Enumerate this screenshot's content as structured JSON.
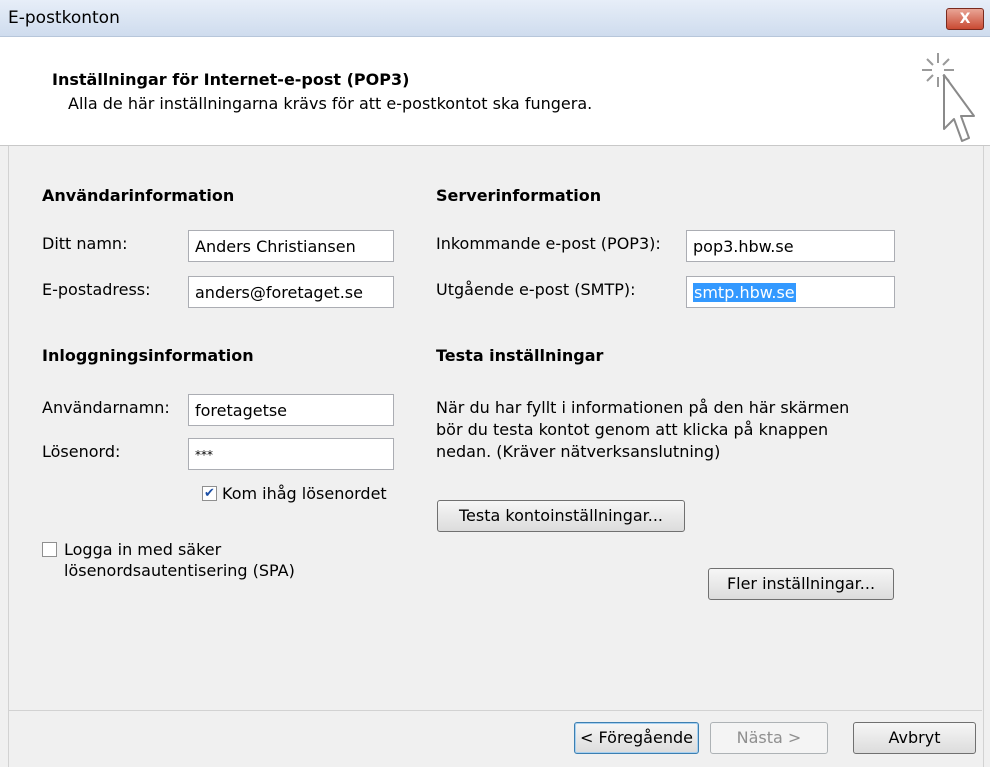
{
  "window": {
    "title": "E-postkonton",
    "close_label": "X"
  },
  "header": {
    "title": "Inställningar för Internet-e-post (POP3)",
    "subtitle": "Alla de här inställningarna krävs för att e-postkontot ska fungera.",
    "icon": "sparkle-cursor-icon"
  },
  "user_info": {
    "heading": "Användarinformation",
    "name_label": "Ditt namn:",
    "name_value": "Anders Christiansen",
    "email_label": "E-postadress:",
    "email_value": "anders@foretaget.se"
  },
  "server_info": {
    "heading": "Serverinformation",
    "incoming_label": "Inkommande e-post (POP3):",
    "incoming_value": "pop3.hbw.se",
    "outgoing_label": "Utgående e-post (SMTP):",
    "outgoing_value": "smtp.hbw.se"
  },
  "login_info": {
    "heading": "Inloggningsinformation",
    "username_label": "Användarnamn:",
    "username_value": "foretagetse",
    "password_label": "Lösenord:",
    "password_value": "***",
    "remember_label": "Kom ihåg lösenordet",
    "remember_checked": true,
    "spa_label_line1": "Logga in med säker",
    "spa_label_line2": "lösenordsautentisering (SPA)",
    "spa_checked": false
  },
  "test_settings": {
    "heading": "Testa inställningar",
    "description_line1": "När du har fyllt i informationen på den här skärmen",
    "description_line2": "bör du testa kontot genom att klicka på knappen",
    "description_line3": "nedan. (Kräver nätverksanslutning)",
    "test_button": "Testa kontoinställningar...",
    "more_button": "Fler inställningar..."
  },
  "footer": {
    "back_button": "< Föregående",
    "next_button": "Nästa >",
    "cancel_button": "Avbryt"
  }
}
